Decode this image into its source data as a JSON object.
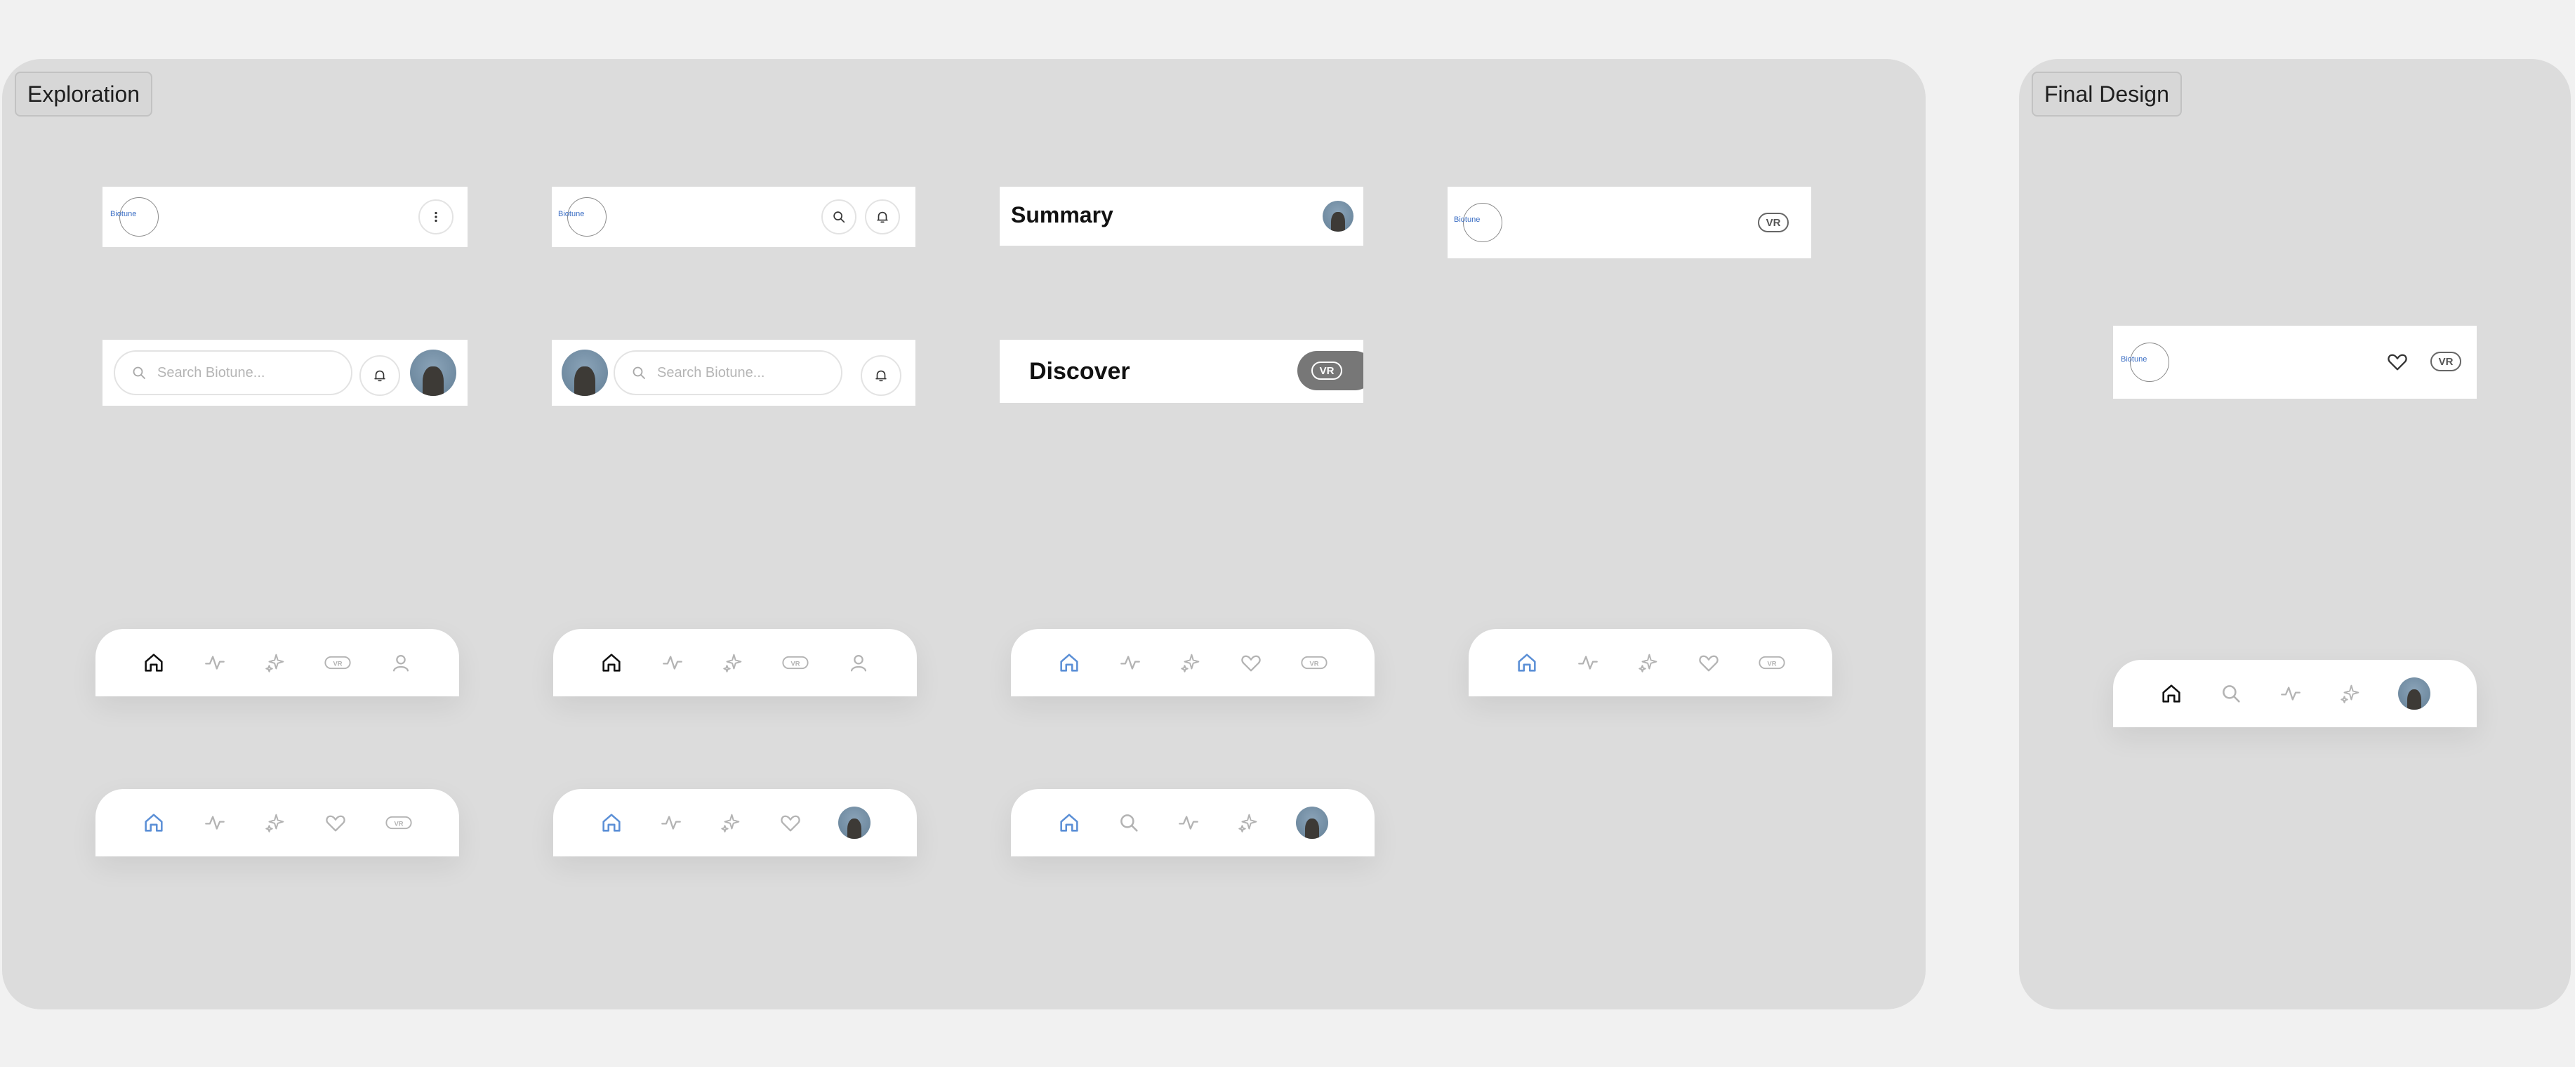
{
  "sections": {
    "exploration": {
      "label": "Exploration"
    },
    "final": {
      "label": "Final Design"
    }
  },
  "brand": {
    "logo_text": "Biotune"
  },
  "search": {
    "placeholder": "Search Biotune..."
  },
  "headers": {
    "summary": "Summary",
    "discover": "Discover"
  },
  "badges": {
    "vr": "VR"
  },
  "icons": [
    "home-icon",
    "activity-icon",
    "sparkle-icon",
    "vr-icon",
    "profile-icon",
    "heart-icon",
    "search-icon",
    "bell-icon",
    "more-icon"
  ],
  "colors": {
    "active_blue": "#5b8fd6",
    "active_dark": "#111111",
    "inactive": "#b3b3b3",
    "vr_pill": "#777777"
  }
}
